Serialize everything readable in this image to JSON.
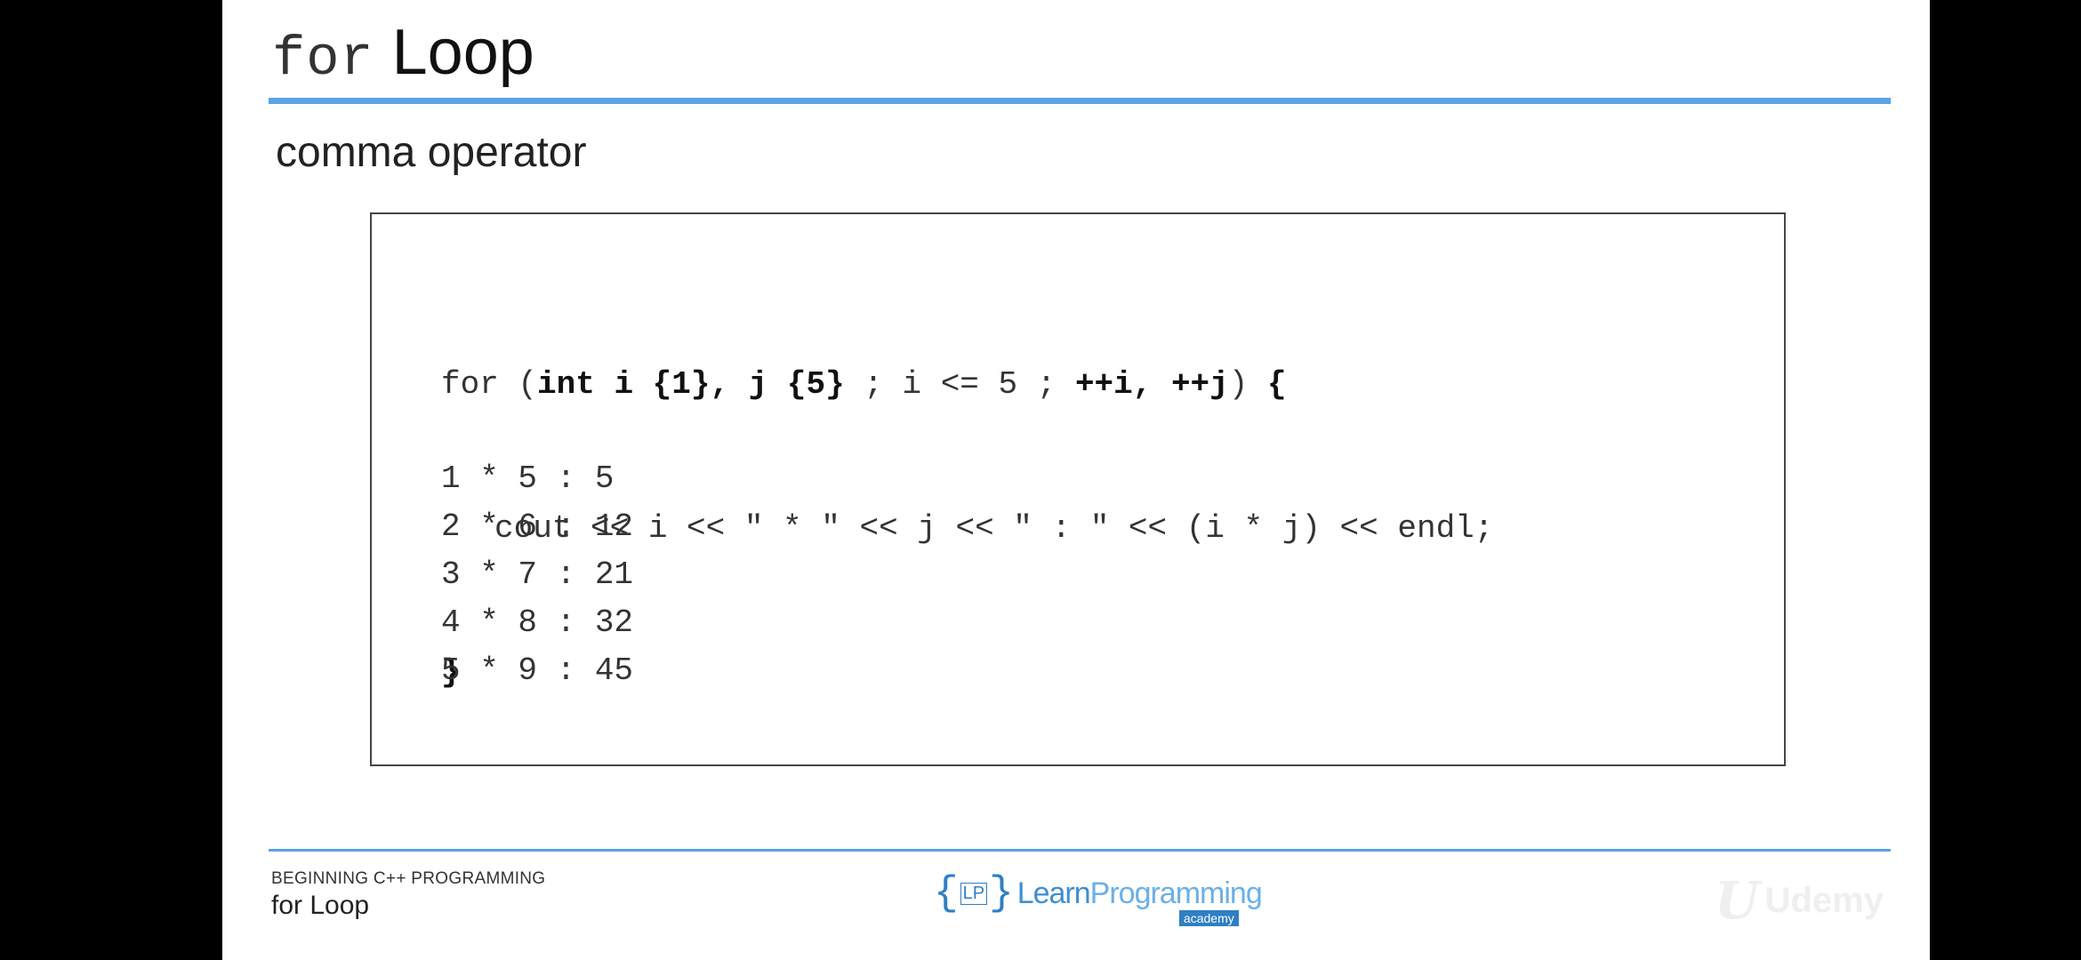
{
  "slide": {
    "title_code": "for",
    "title_text": "Loop",
    "subtitle": "comma operator"
  },
  "code": {
    "line1": [
      {
        "text": "for (",
        "bold": false
      },
      {
        "text": "int i {1}, j {5}",
        "bold": true
      },
      {
        "text": " ; i <= 5 ; ",
        "bold": false
      },
      {
        "text": "++i, ++j",
        "bold": true
      },
      {
        "text": ") ",
        "bold": false
      },
      {
        "text": "{",
        "bold": true
      }
    ],
    "line2": "cout << i << \" * \" << j << \" : \" << (i * j) << endl;",
    "line3": "}"
  },
  "output": [
    "1 * 5 : 5",
    "2 * 6 : 12",
    "3 * 7 : 21",
    "4 * 8 : 32",
    "5 * 9 : 45"
  ],
  "footer": {
    "course": "BEGINNING C++ PROGRAMMING",
    "topic": "for Loop",
    "logo_bracket_open": "{",
    "logo_lp": "LP",
    "logo_bracket_close": "}",
    "logo_learn": "Learn",
    "logo_programming": "Programming",
    "logo_academy": "academy"
  },
  "watermark": {
    "mark": "U",
    "text": "Udemy"
  }
}
